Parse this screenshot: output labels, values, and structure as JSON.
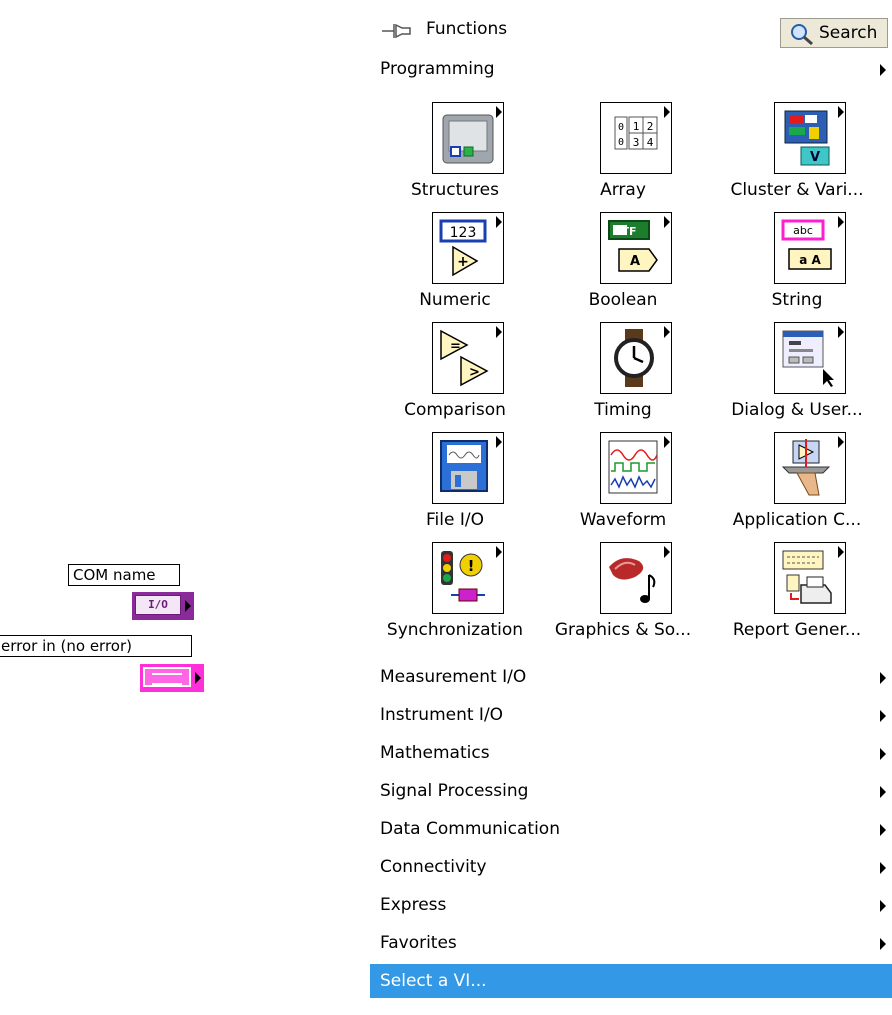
{
  "block_diagram": {
    "com_name_label": "COM name",
    "com_terminal_text": "I/O",
    "error_in_label": "error in (no error)"
  },
  "palette": {
    "title": "Functions",
    "search_label": "Search",
    "category": "Programming",
    "tiles": [
      {
        "label": "Structures",
        "icon": "structures-icon"
      },
      {
        "label": "Array",
        "icon": "array-icon"
      },
      {
        "label": "Cluster & Vari...",
        "icon": "cluster-icon"
      },
      {
        "label": "Numeric",
        "icon": "numeric-icon"
      },
      {
        "label": "Boolean",
        "icon": "boolean-icon"
      },
      {
        "label": "String",
        "icon": "string-icon"
      },
      {
        "label": "Comparison",
        "icon": "comparison-icon"
      },
      {
        "label": "Timing",
        "icon": "timing-icon"
      },
      {
        "label": "Dialog & User...",
        "icon": "dialog-icon"
      },
      {
        "label": "File I/O",
        "icon": "file-io-icon"
      },
      {
        "label": "Waveform",
        "icon": "waveform-icon"
      },
      {
        "label": "Application C...",
        "icon": "application-control-icon"
      },
      {
        "label": "Synchronization",
        "icon": "synchronization-icon"
      },
      {
        "label": "Graphics & So...",
        "icon": "graphics-sound-icon"
      },
      {
        "label": "Report Gener...",
        "icon": "report-generation-icon"
      }
    ],
    "tile_icon_texts": {
      "array": [
        "0",
        "1",
        "2",
        "0",
        "3",
        "4"
      ],
      "numeric": "123",
      "boolean": "TF",
      "boolean_a": "A",
      "string_top": "abc",
      "string_bottom": "a A"
    },
    "menu_items": [
      "Measurement I/O",
      "Instrument I/O",
      "Mathematics",
      "Signal Processing",
      "Data Communication",
      "Connectivity",
      "Express",
      "Favorites"
    ],
    "select_vi": "Select a VI...",
    "colors": {
      "selection": "#3399e6",
      "com_terminal": "#8a2b9a",
      "error_terminal": "#ff2fd9"
    }
  }
}
